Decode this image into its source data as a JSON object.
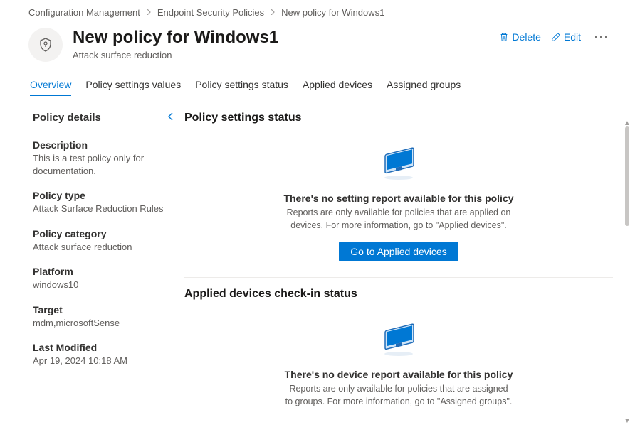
{
  "breadcrumb": {
    "items": [
      "Configuration Management",
      "Endpoint Security Policies",
      "New policy for Windows1"
    ]
  },
  "header": {
    "title": "New policy for Windows1",
    "subtitle": "Attack surface reduction",
    "delete_label": "Delete",
    "edit_label": "Edit"
  },
  "tabs": {
    "items": [
      "Overview",
      "Policy settings values",
      "Policy settings status",
      "Applied devices",
      "Assigned groups"
    ],
    "active_index": 0
  },
  "details": {
    "panel_title": "Policy details",
    "items": [
      {
        "label": "Description",
        "value": "This is a test policy only for documentation."
      },
      {
        "label": "Policy type",
        "value": "Attack Surface Reduction Rules"
      },
      {
        "label": "Policy category",
        "value": "Attack surface reduction"
      },
      {
        "label": "Platform",
        "value": "windows10"
      },
      {
        "label": "Target",
        "value": "mdm,microsoftSense"
      },
      {
        "label": "Last Modified",
        "value": "Apr 19, 2024 10:18 AM"
      }
    ]
  },
  "main": {
    "section1": {
      "title": "Policy settings status",
      "empty_title": "There's no setting report available for this policy",
      "empty_desc": "Reports are only available for policies that are applied on devices. For more information, go to \"Applied devices\".",
      "button": "Go to Applied devices"
    },
    "section2": {
      "title": "Applied devices check-in status",
      "empty_title": "There's no device report available for this policy",
      "empty_desc": "Reports are only available for policies that are assigned to groups. For more information, go to \"Assigned groups\"."
    }
  }
}
